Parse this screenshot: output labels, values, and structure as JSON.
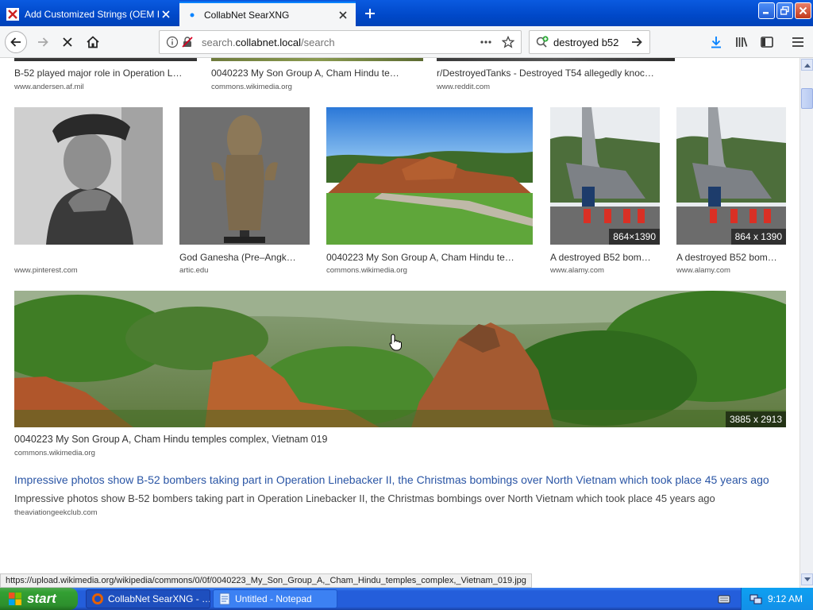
{
  "tabs": [
    {
      "title": "Add Customized Strings (OEM Info",
      "active": false
    },
    {
      "title": "CollabNet SearXNG",
      "active": true
    }
  ],
  "navbar": {
    "url_prefix": "search.",
    "url_domain": "collabnet.local",
    "url_path": "/search",
    "search_query": "destroyed b52"
  },
  "results_row1": [
    {
      "caption": "B-52 played major role in Operation L…",
      "source": "www.andersen.af.mil"
    },
    {
      "caption": "0040223 My Son Group A, Cham Hindu te…",
      "source": "commons.wikimedia.org"
    },
    {
      "caption": "r/DestroyedTanks - Destroyed T54 allegedly knoc…",
      "source": "www.reddit.com"
    }
  ],
  "results_row2": [
    {
      "caption": "",
      "source": "www.pinterest.com",
      "dimensions": ""
    },
    {
      "caption": "God Ganesha (Pre–Angk…",
      "source": "artic.edu",
      "dimensions": ""
    },
    {
      "caption": "0040223 My Son Group A, Cham Hindu te…",
      "source": "commons.wikimedia.org",
      "dimensions": ""
    },
    {
      "caption": "A destroyed B52 bom…",
      "source": "www.alamy.com",
      "dimensions": "864×1390"
    },
    {
      "caption": "A destroyed B52 bom…",
      "source": "www.alamy.com",
      "dimensions": "864 x 1390"
    }
  ],
  "featured": {
    "caption": "0040223 My Son Group A, Cham Hindu temples complex, Vietnam 019",
    "source": "commons.wikimedia.org",
    "dimensions": "3885 x 2913"
  },
  "link_result": {
    "title": "Impressive photos show B-52 bombers taking part in Operation Linebacker II, the Christmas bombings over North Vietnam which took place 45 years ago",
    "description": "Impressive photos show B-52 bombers taking part in Operation Linebacker II, the Christmas bombings over North Vietnam which took place 45 years ago",
    "url": "theaviationgeekclub.com"
  },
  "status_url": "https://upload.wikimedia.org/wikipedia/commons/0/0f/0040223_My_Son_Group_A,_Cham_Hindu_temples_complex,_Vietnam_019.jpg",
  "taskbar": {
    "start": "start",
    "tasks": [
      {
        "label": "CollabNet SearXNG - …",
        "active": true
      },
      {
        "label": "Untitled - Notepad",
        "active": false
      }
    ],
    "clock": "9:12 AM"
  },
  "colors": {
    "titlebar": "#0a5ae0",
    "accent": "#0a84ff",
    "link": "#2a55a5",
    "taskbar": "#245edb",
    "start": "#33a033"
  }
}
